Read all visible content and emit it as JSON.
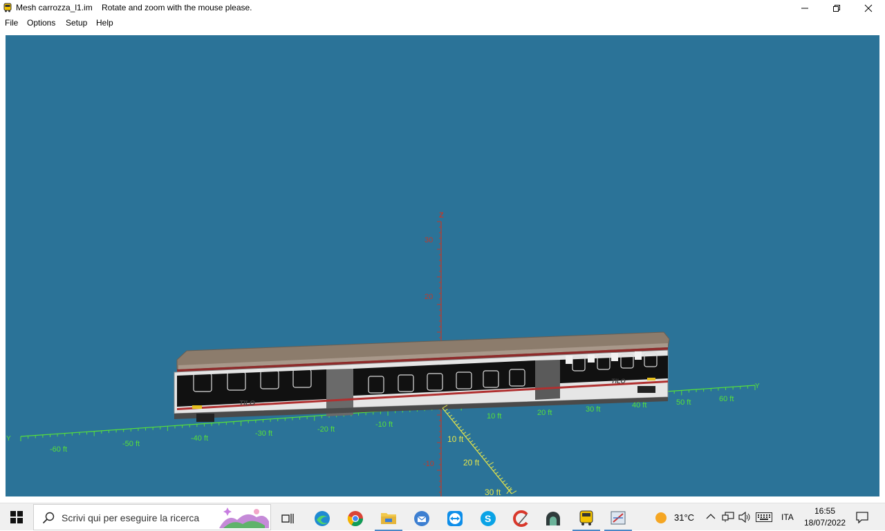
{
  "window": {
    "title": "Mesh carrozza_l1.im",
    "hint": "Rotate and zoom with the mouse please."
  },
  "menu": {
    "items": [
      "File",
      "Options",
      "Setup",
      "Help"
    ]
  },
  "viewport": {
    "background": "#2b7398",
    "z_axis": {
      "label": "Z",
      "ticks": [
        "30",
        "20",
        "-10"
      ],
      "color": "#c0392b"
    },
    "y_axis": {
      "label": "Y",
      "ticks_neg": [
        "-60 ft",
        "-50 ft",
        "-40 ft",
        "-30 ft",
        "-20 ft",
        "-10 ft"
      ],
      "ticks_pos": [
        "10 ft",
        "20 ft",
        "30 ft",
        "40 ft",
        "50 ft",
        "60 ft"
      ],
      "color": "#57e03a"
    },
    "x_axis": {
      "label": "X",
      "ticks": [
        "10 ft",
        "20 ft",
        "30 ft"
      ],
      "color": "#e6e64a"
    },
    "model": {
      "livery_text": "TILO"
    }
  },
  "taskbar": {
    "search_placeholder": "Scrivi qui per eseguire la ricerca",
    "weather": "31°C",
    "language": "ITA",
    "time": "16:55",
    "date": "18/07/2022",
    "icons": [
      "task-view-icon",
      "edge-icon",
      "chrome-icon",
      "file-explorer-icon",
      "thunderbird-icon",
      "teamviewer-icon",
      "skype-icon",
      "ccleaner-icon",
      "tunnel-icon",
      "trainz-icon",
      "mesh-viewer-icon"
    ]
  }
}
